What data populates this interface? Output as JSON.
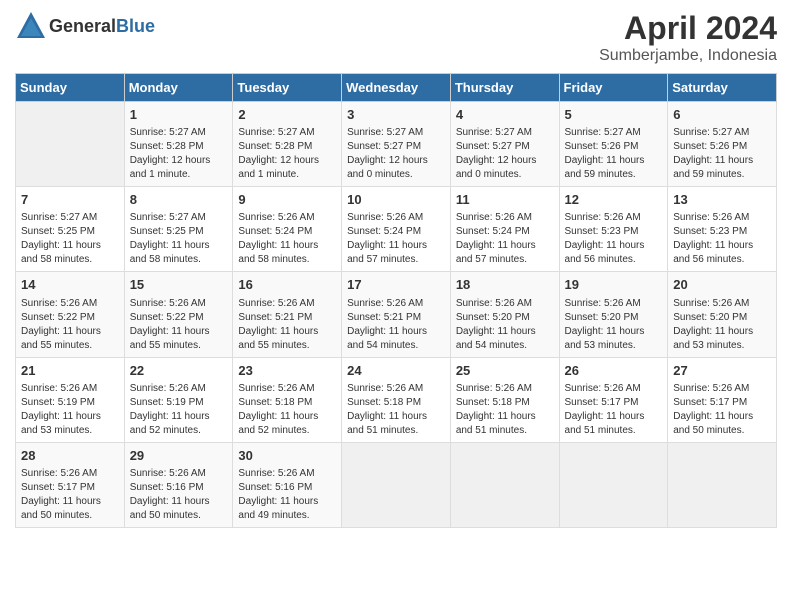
{
  "header": {
    "logo_general": "General",
    "logo_blue": "Blue",
    "title": "April 2024",
    "subtitle": "Sumberjambe, Indonesia"
  },
  "calendar": {
    "weekdays": [
      "Sunday",
      "Monday",
      "Tuesday",
      "Wednesday",
      "Thursday",
      "Friday",
      "Saturday"
    ],
    "weeks": [
      [
        {
          "day": "",
          "info": ""
        },
        {
          "day": "1",
          "info": "Sunrise: 5:27 AM\nSunset: 5:28 PM\nDaylight: 12 hours\nand 1 minute."
        },
        {
          "day": "2",
          "info": "Sunrise: 5:27 AM\nSunset: 5:28 PM\nDaylight: 12 hours\nand 1 minute."
        },
        {
          "day": "3",
          "info": "Sunrise: 5:27 AM\nSunset: 5:27 PM\nDaylight: 12 hours\nand 0 minutes."
        },
        {
          "day": "4",
          "info": "Sunrise: 5:27 AM\nSunset: 5:27 PM\nDaylight: 12 hours\nand 0 minutes."
        },
        {
          "day": "5",
          "info": "Sunrise: 5:27 AM\nSunset: 5:26 PM\nDaylight: 11 hours\nand 59 minutes."
        },
        {
          "day": "6",
          "info": "Sunrise: 5:27 AM\nSunset: 5:26 PM\nDaylight: 11 hours\nand 59 minutes."
        }
      ],
      [
        {
          "day": "7",
          "info": "Sunrise: 5:27 AM\nSunset: 5:25 PM\nDaylight: 11 hours\nand 58 minutes."
        },
        {
          "day": "8",
          "info": "Sunrise: 5:27 AM\nSunset: 5:25 PM\nDaylight: 11 hours\nand 58 minutes."
        },
        {
          "day": "9",
          "info": "Sunrise: 5:26 AM\nSunset: 5:24 PM\nDaylight: 11 hours\nand 58 minutes."
        },
        {
          "day": "10",
          "info": "Sunrise: 5:26 AM\nSunset: 5:24 PM\nDaylight: 11 hours\nand 57 minutes."
        },
        {
          "day": "11",
          "info": "Sunrise: 5:26 AM\nSunset: 5:24 PM\nDaylight: 11 hours\nand 57 minutes."
        },
        {
          "day": "12",
          "info": "Sunrise: 5:26 AM\nSunset: 5:23 PM\nDaylight: 11 hours\nand 56 minutes."
        },
        {
          "day": "13",
          "info": "Sunrise: 5:26 AM\nSunset: 5:23 PM\nDaylight: 11 hours\nand 56 minutes."
        }
      ],
      [
        {
          "day": "14",
          "info": "Sunrise: 5:26 AM\nSunset: 5:22 PM\nDaylight: 11 hours\nand 55 minutes."
        },
        {
          "day": "15",
          "info": "Sunrise: 5:26 AM\nSunset: 5:22 PM\nDaylight: 11 hours\nand 55 minutes."
        },
        {
          "day": "16",
          "info": "Sunrise: 5:26 AM\nSunset: 5:21 PM\nDaylight: 11 hours\nand 55 minutes."
        },
        {
          "day": "17",
          "info": "Sunrise: 5:26 AM\nSunset: 5:21 PM\nDaylight: 11 hours\nand 54 minutes."
        },
        {
          "day": "18",
          "info": "Sunrise: 5:26 AM\nSunset: 5:20 PM\nDaylight: 11 hours\nand 54 minutes."
        },
        {
          "day": "19",
          "info": "Sunrise: 5:26 AM\nSunset: 5:20 PM\nDaylight: 11 hours\nand 53 minutes."
        },
        {
          "day": "20",
          "info": "Sunrise: 5:26 AM\nSunset: 5:20 PM\nDaylight: 11 hours\nand 53 minutes."
        }
      ],
      [
        {
          "day": "21",
          "info": "Sunrise: 5:26 AM\nSunset: 5:19 PM\nDaylight: 11 hours\nand 53 minutes."
        },
        {
          "day": "22",
          "info": "Sunrise: 5:26 AM\nSunset: 5:19 PM\nDaylight: 11 hours\nand 52 minutes."
        },
        {
          "day": "23",
          "info": "Sunrise: 5:26 AM\nSunset: 5:18 PM\nDaylight: 11 hours\nand 52 minutes."
        },
        {
          "day": "24",
          "info": "Sunrise: 5:26 AM\nSunset: 5:18 PM\nDaylight: 11 hours\nand 51 minutes."
        },
        {
          "day": "25",
          "info": "Sunrise: 5:26 AM\nSunset: 5:18 PM\nDaylight: 11 hours\nand 51 minutes."
        },
        {
          "day": "26",
          "info": "Sunrise: 5:26 AM\nSunset: 5:17 PM\nDaylight: 11 hours\nand 51 minutes."
        },
        {
          "day": "27",
          "info": "Sunrise: 5:26 AM\nSunset: 5:17 PM\nDaylight: 11 hours\nand 50 minutes."
        }
      ],
      [
        {
          "day": "28",
          "info": "Sunrise: 5:26 AM\nSunset: 5:17 PM\nDaylight: 11 hours\nand 50 minutes."
        },
        {
          "day": "29",
          "info": "Sunrise: 5:26 AM\nSunset: 5:16 PM\nDaylight: 11 hours\nand 50 minutes."
        },
        {
          "day": "30",
          "info": "Sunrise: 5:26 AM\nSunset: 5:16 PM\nDaylight: 11 hours\nand 49 minutes."
        },
        {
          "day": "",
          "info": ""
        },
        {
          "day": "",
          "info": ""
        },
        {
          "day": "",
          "info": ""
        },
        {
          "day": "",
          "info": ""
        }
      ]
    ]
  }
}
